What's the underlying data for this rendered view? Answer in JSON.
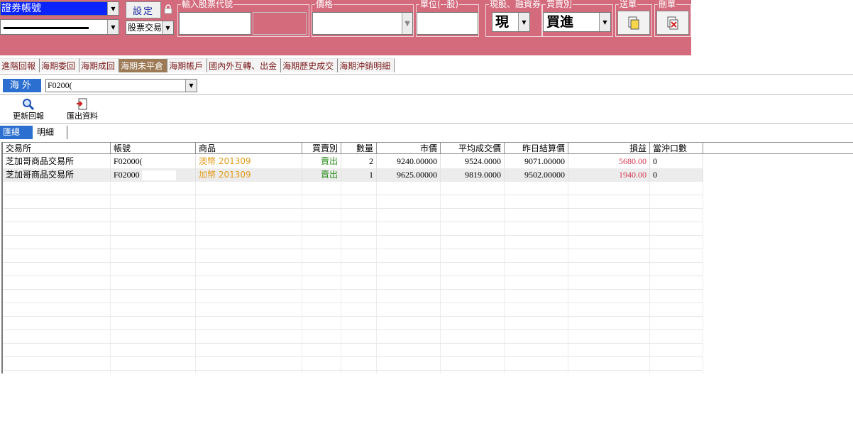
{
  "order_panel": {
    "account_label": "證券帳號",
    "setting_label": "設定",
    "trade_type": "股票交易",
    "stock_code_label": "輸入股票代號",
    "price_label": "價格",
    "unit_label": "單位(--股)",
    "cash_margin_label": "現股、融資券",
    "cash_margin_value": "現",
    "buy_sell_label": "買賣別",
    "buy_sell_value": "買進",
    "send_label": "送單",
    "delete_label": "刪單"
  },
  "tabs": [
    "進階回報",
    "海期委回",
    "海期成回",
    "海期未平倉",
    "海期帳戶",
    "國內外互轉、出金",
    "海期歷史成交",
    "海期沖銷明細"
  ],
  "active_tab": 3,
  "overseas": {
    "label": "海外",
    "account": "F0200("
  },
  "toolbar": {
    "refresh_label": "更新回報",
    "export_label": "匯出資料"
  },
  "subtabs": {
    "summary": "匯總",
    "detail": "明細"
  },
  "grid": {
    "columns": [
      "交易所",
      "帳號",
      "商品",
      "買賣別",
      "數量",
      "市價",
      "平均成交價",
      "昨日結算價",
      "損益",
      "當沖口數"
    ],
    "rows": [
      [
        "芝加哥商品交易所",
        "F02000(",
        "澳幣 201309",
        "賣出",
        "2",
        "9240.00000",
        "9524.0000",
        "9071.00000",
        "5680.00",
        "0"
      ],
      [
        "芝加哥商品交易所",
        "F02000",
        "加幣 201309",
        "賣出",
        "1",
        "9625.00000",
        "9819.0000",
        "9502.00000",
        "1940.00",
        "0"
      ]
    ]
  },
  "colors": {
    "panel": "#d36b7d",
    "accent_blue": "#2b6fd0",
    "product": "#e39b1a",
    "sell": "#2a8a1a",
    "pnl": "#d43a52"
  }
}
